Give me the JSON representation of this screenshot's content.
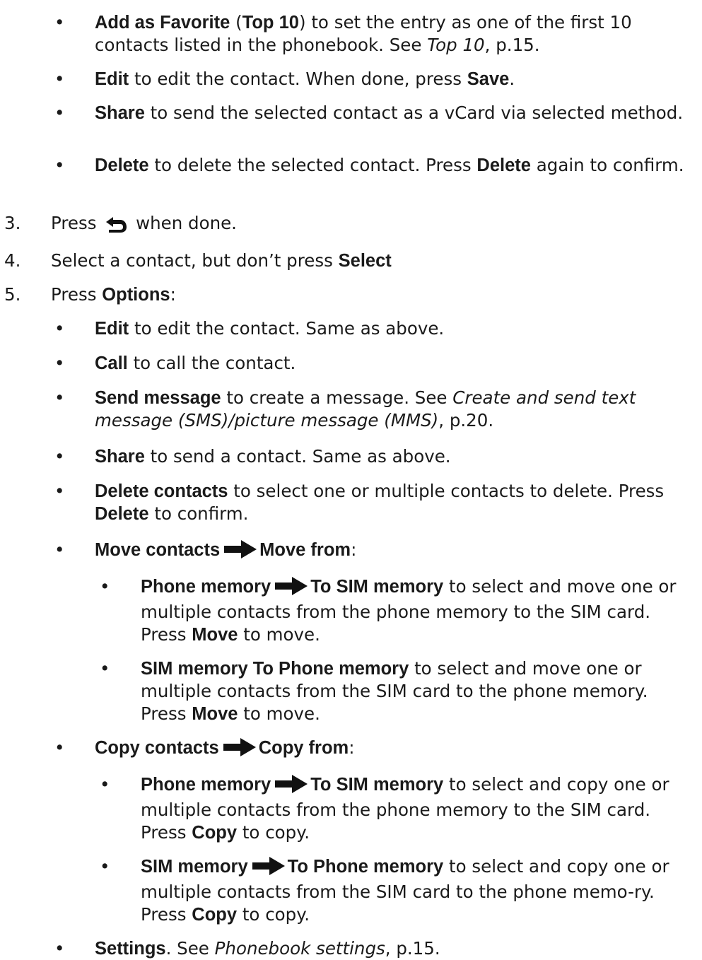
{
  "bullet_char": "•",
  "items": {
    "fav": {
      "bold1": "Add as Favorite",
      "p1": " (",
      "bold2": "Top 10",
      "p2": ") to set the entry as one of the first 10 contacts listed in the phonebook. See ",
      "ital": "Top 10",
      "p3": ", p.15."
    },
    "edit1": {
      "bold1": "Edit",
      "p1": " to edit the contact. When done, press ",
      "bold2": "Save",
      "p2": "."
    },
    "share1": {
      "bold1": "Share",
      "p1": " to send the selected contact as a vCard via selected method."
    },
    "delete1": {
      "bold1": "Delete",
      "p1": " to delete the selected contact. Press ",
      "bold2": "Delete",
      "p2": " again to confirm."
    },
    "step3": {
      "num": "3.",
      "p1": "Press ",
      "p2": " when done.",
      "icon": "back-arrow-icon"
    },
    "step4": {
      "num": "4.",
      "p1": "Select a contact, but don’t press ",
      "bold1": "Select"
    },
    "step5": {
      "num": "5.",
      "p1": "Press ",
      "bold1": "Options",
      "p2": ":"
    },
    "edit2": {
      "bold1": "Edit",
      "p1": " to edit the contact. Same as above."
    },
    "call": {
      "bold1": "Call",
      "p1": " to call the contact."
    },
    "sendmsg": {
      "bold1": "Send message",
      "p1": " to create a message. See ",
      "ital": "Create and send text message (SMS)/picture message (MMS)",
      "p2": ", p.20."
    },
    "share2": {
      "bold1": "Share",
      "p1": " to send a contact. Same as above."
    },
    "delcontacts": {
      "bold1": "Delete contacts",
      "p1": " to select one or multiple contacts to delete. Press ",
      "bold2": "Delete",
      "p2": " to confirm."
    },
    "move": {
      "bold1": "Move contacts",
      "bold2": "Move from",
      "p1": ":",
      "icon": "right-arrow-icon"
    },
    "move_p2s": {
      "bold1": "Phone memory",
      "bold2": "To SIM memory",
      "p1": " to select and move one or multiple contacts from the phone memory to the SIM card. Press ",
      "bold3": "Move",
      "p2": " to move."
    },
    "move_s2p": {
      "bold1": "SIM memory To Phone memory",
      "p1": " to select and move one or multiple contacts from the SIM card to the phone memory. Press ",
      "bold2": "Move",
      "p2": " to move."
    },
    "copy": {
      "bold1": "Copy contacts",
      "bold2": "Copy from",
      "p1": ":"
    },
    "copy_p2s": {
      "bold1": "Phone memory",
      "bold2": "To SIM memory",
      "p1": " to select and copy one or multiple contacts from the phone memory to the SIM card. Press ",
      "bold3": "Copy",
      "p2": " to copy."
    },
    "copy_s2p": {
      "bold1": "SIM memory",
      "bold2": "To Phone memory",
      "p1": " to select and copy one or multiple contacts from the SIM card to the phone memo-ry. Press ",
      "bold3": "Copy",
      "p2": " to copy."
    },
    "settings": {
      "bold1": "Settings",
      "p1": ". See ",
      "ital": "Phonebook settings",
      "p2": ", p.15."
    }
  }
}
